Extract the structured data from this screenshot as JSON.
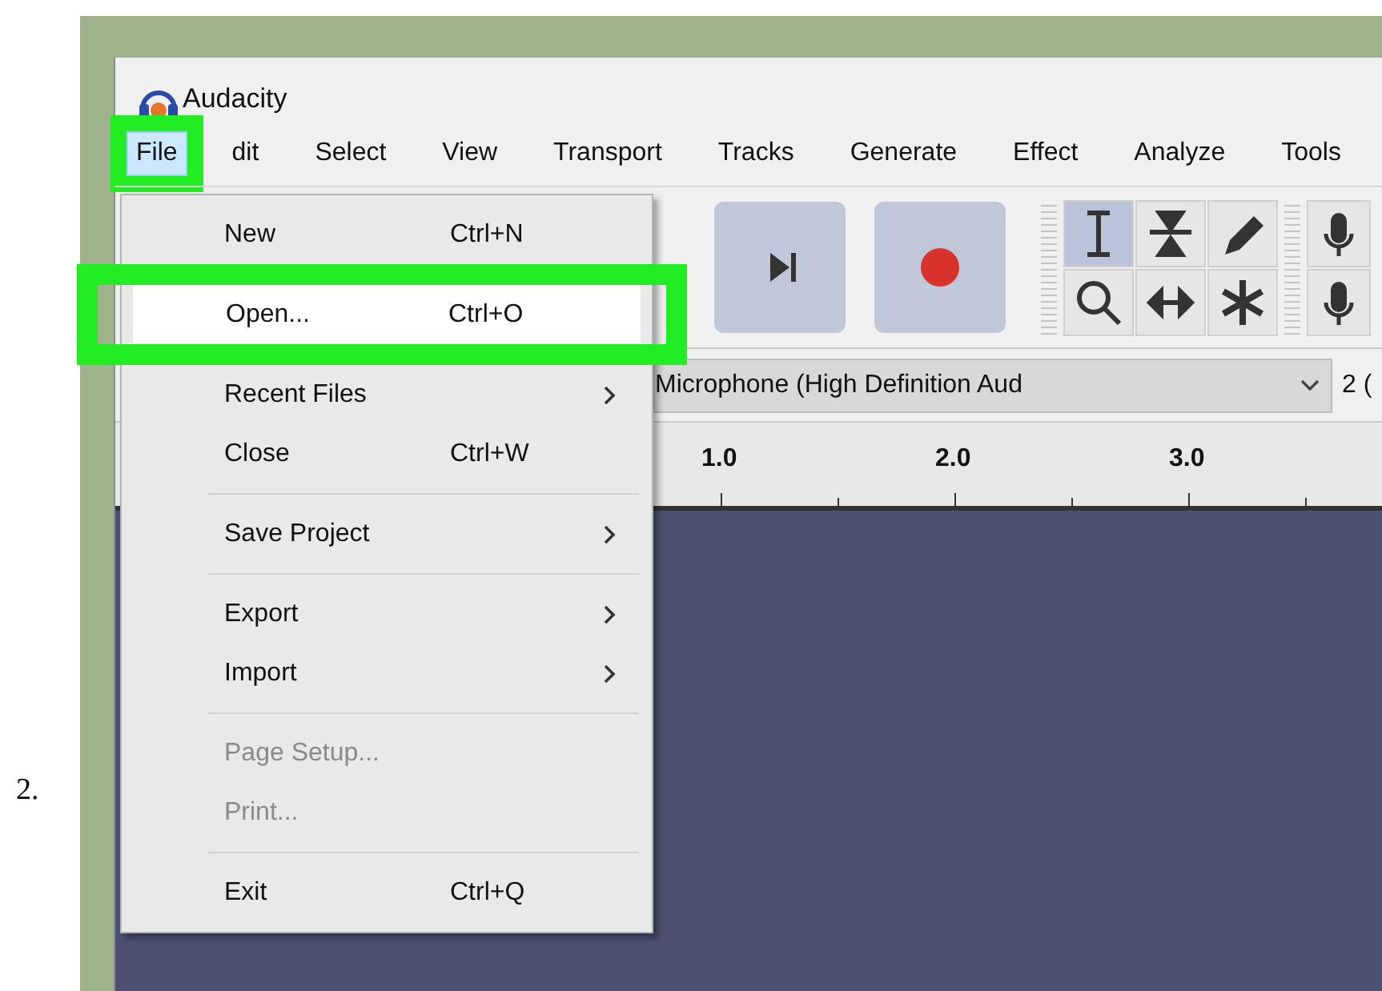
{
  "list_number": "2.",
  "window": {
    "title": "Audacity"
  },
  "menu_bar": [
    {
      "label": "File",
      "selected": true,
      "annotated": true
    },
    {
      "label": "dit",
      "selected": false,
      "annotated": false
    },
    {
      "label": "Select",
      "selected": false,
      "annotated": false
    },
    {
      "label": "View",
      "selected": false,
      "annotated": false
    },
    {
      "label": "Transport",
      "selected": false,
      "annotated": false
    },
    {
      "label": "Tracks",
      "selected": false,
      "annotated": false
    },
    {
      "label": "Generate",
      "selected": false,
      "annotated": false
    },
    {
      "label": "Effect",
      "selected": false,
      "annotated": false
    },
    {
      "label": "Analyze",
      "selected": false,
      "annotated": false
    },
    {
      "label": "Tools",
      "selected": false,
      "annotated": false
    }
  ],
  "transport": [
    {
      "kind": "skip-end"
    },
    {
      "kind": "record"
    }
  ],
  "tools": [
    {
      "kind": "ibeam",
      "selected": true
    },
    {
      "kind": "envelope",
      "selected": false
    },
    {
      "kind": "pencil",
      "selected": false
    },
    {
      "kind": "zoom",
      "selected": false
    },
    {
      "kind": "timeshift",
      "selected": false
    },
    {
      "kind": "multi",
      "selected": false
    }
  ],
  "device": {
    "value": "Microphone (High Definition Aud",
    "channels": "2 ("
  },
  "ruler": {
    "ticks": [
      "1.0",
      "2.0",
      "3.0"
    ]
  },
  "file_menu": [
    {
      "kind": "item",
      "label": "New",
      "shortcut": "Ctrl+N",
      "submenu": false,
      "disabled": false,
      "selected": false,
      "annotated": false
    },
    {
      "kind": "item",
      "label": "Open...",
      "shortcut": "Ctrl+O",
      "submenu": false,
      "disabled": false,
      "selected": true,
      "annotated": true
    },
    {
      "kind": "item",
      "label": "Recent Files",
      "submenu": true,
      "disabled": false,
      "selected": false,
      "annotated": false
    },
    {
      "kind": "item",
      "label": "Close",
      "shortcut": "Ctrl+W",
      "submenu": false,
      "disabled": false,
      "selected": false,
      "annotated": false
    },
    {
      "kind": "separator"
    },
    {
      "kind": "item",
      "label": "Save Project",
      "submenu": true,
      "disabled": false,
      "selected": false,
      "annotated": false
    },
    {
      "kind": "separator"
    },
    {
      "kind": "item",
      "label": "Export",
      "submenu": true,
      "disabled": false,
      "selected": false,
      "annotated": false
    },
    {
      "kind": "item",
      "label": "Import",
      "submenu": true,
      "disabled": false,
      "selected": false,
      "annotated": false
    },
    {
      "kind": "separator"
    },
    {
      "kind": "item",
      "label": "Page Setup...",
      "submenu": false,
      "disabled": true,
      "selected": false,
      "annotated": false
    },
    {
      "kind": "item",
      "label": "Print...",
      "submenu": false,
      "disabled": true,
      "selected": false,
      "annotated": false
    },
    {
      "kind": "separator"
    },
    {
      "kind": "item",
      "label": "Exit",
      "shortcut": "Ctrl+Q",
      "submenu": false,
      "disabled": false,
      "selected": false,
      "annotated": false
    }
  ]
}
